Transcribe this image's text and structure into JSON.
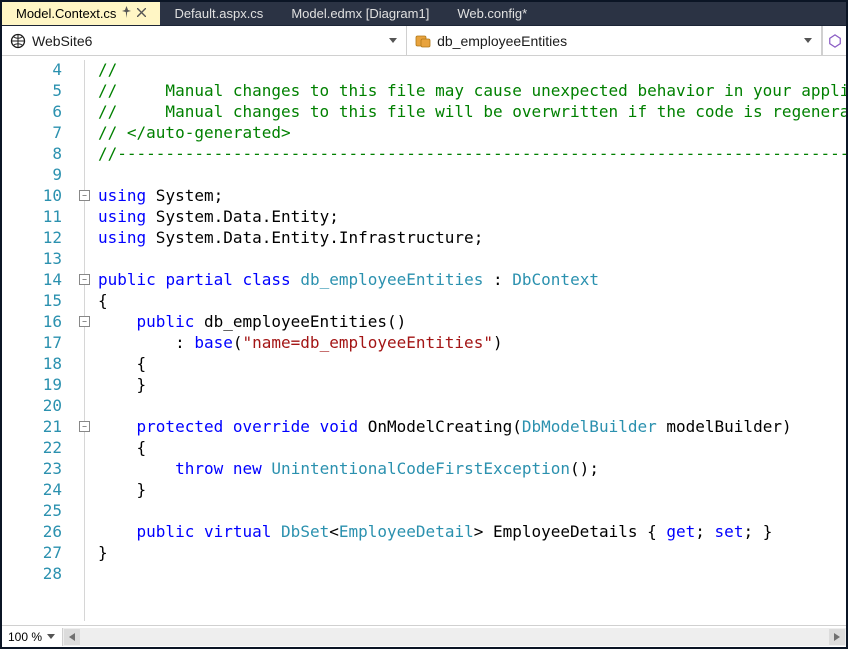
{
  "tabs": [
    {
      "label": "Model.Context.cs",
      "active": true,
      "pinned": true,
      "closable": true
    },
    {
      "label": "Default.aspx.cs",
      "active": false
    },
    {
      "label": "Model.edmx [Diagram1]",
      "active": false
    },
    {
      "label": "Web.config*",
      "active": false
    }
  ],
  "nav": {
    "left_label": "WebSite6",
    "right_label": "db_employeeEntities"
  },
  "zoom": {
    "label": "100 %"
  },
  "code": {
    "lines": [
      {
        "n": 4,
        "html": "<span class='c-comment'>//</span>"
      },
      {
        "n": 5,
        "html": "<span class='c-comment'>//     Manual changes to this file may cause unexpected behavior in your applicat</span>"
      },
      {
        "n": 6,
        "html": "<span class='c-comment'>//     Manual changes to this file will be overwritten if the code is regenerated</span>"
      },
      {
        "n": 7,
        "html": "<span class='c-comment'>// &lt;/auto-generated&gt;</span>"
      },
      {
        "n": 8,
        "html": "<span class='c-comment'>//------------------------------------------------------------------------------------</span>"
      },
      {
        "n": 9,
        "html": ""
      },
      {
        "n": 10,
        "fold": "-",
        "html": "<span class='c-key'>using</span><span class='c-plain'> System;</span>"
      },
      {
        "n": 11,
        "html": "<span class='c-key'>using</span><span class='c-plain'> System.Data.Entity;</span>"
      },
      {
        "n": 12,
        "html": "<span class='c-key'>using</span><span class='c-plain'> System.Data.Entity.Infrastructure;</span>"
      },
      {
        "n": 13,
        "html": ""
      },
      {
        "n": 14,
        "fold": "-",
        "html": "<span class='c-key'>public</span><span class='c-plain'> </span><span class='c-key'>partial</span><span class='c-plain'> </span><span class='c-key'>class</span><span class='c-plain'> </span><span class='c-type'>db_employeeEntities</span><span class='c-plain'> : </span><span class='c-type'>DbContext</span>"
      },
      {
        "n": 15,
        "html": "<span class='c-plain'>{</span>"
      },
      {
        "n": 16,
        "fold": "-",
        "html": "<span class='c-plain'>    </span><span class='c-key'>public</span><span class='c-plain'> db_employeeEntities()</span>"
      },
      {
        "n": 17,
        "html": "<span class='c-plain'>        : </span><span class='c-key'>base</span><span class='c-plain'>(</span><span class='c-str'>\"name=db_employeeEntities\"</span><span class='c-plain'>)</span>"
      },
      {
        "n": 18,
        "html": "<span class='c-plain'>    {</span>"
      },
      {
        "n": 19,
        "html": "<span class='c-plain'>    }</span>"
      },
      {
        "n": 20,
        "html": ""
      },
      {
        "n": 21,
        "fold": "-",
        "html": "<span class='c-plain'>    </span><span class='c-key'>protected</span><span class='c-plain'> </span><span class='c-key'>override</span><span class='c-plain'> </span><span class='c-key'>void</span><span class='c-plain'> OnModelCreating(</span><span class='c-type'>DbModelBuilder</span><span class='c-plain'> modelBuilder)</span>"
      },
      {
        "n": 22,
        "html": "<span class='c-plain'>    {</span>"
      },
      {
        "n": 23,
        "html": "<span class='c-plain'>        </span><span class='c-key'>throw</span><span class='c-plain'> </span><span class='c-key'>new</span><span class='c-plain'> </span><span class='c-type'>UnintentionalCodeFirstException</span><span class='c-plain'>();</span>"
      },
      {
        "n": 24,
        "html": "<span class='c-plain'>    }</span>"
      },
      {
        "n": 25,
        "html": ""
      },
      {
        "n": 26,
        "html": "<span class='c-plain'>    </span><span class='c-key'>public</span><span class='c-plain'> </span><span class='c-key'>virtual</span><span class='c-plain'> </span><span class='c-type'>DbSet</span><span class='c-plain'>&lt;</span><span class='c-type'>EmployeeDetail</span><span class='c-plain'>&gt; EmployeeDetails { </span><span class='c-key'>get</span><span class='c-plain'>; </span><span class='c-key'>set</span><span class='c-plain'>; }</span>"
      },
      {
        "n": 27,
        "html": "<span class='c-plain'>}</span>"
      },
      {
        "n": 28,
        "html": ""
      }
    ]
  }
}
